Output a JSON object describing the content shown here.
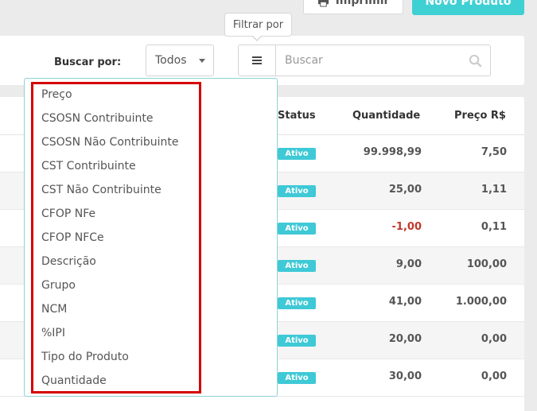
{
  "header": {
    "print_label": "Imprimir",
    "new_product_label": "Novo Produto",
    "tooltip": "Filtrar por"
  },
  "filter": {
    "search_by_label": "Buscar por:",
    "select_value": "Todos",
    "search_placeholder": "Buscar"
  },
  "table": {
    "columns": {
      "status": "Status",
      "quantidade": "Quantidade",
      "preco": "Preço R$"
    },
    "rows": [
      {
        "status": "Ativo",
        "quantidade": "99.998,99",
        "preco": "7,50"
      },
      {
        "status": "Ativo",
        "quantidade": "25,00",
        "preco": "1,11"
      },
      {
        "status": "Ativo",
        "quantidade": "-1,00",
        "preco": "0,11"
      },
      {
        "status": "Ativo",
        "quantidade": "9,00",
        "preco": "100,00"
      },
      {
        "status": "Ativo",
        "quantidade": "41,00",
        "preco": "1.000,00"
      },
      {
        "status": "Ativo",
        "quantidade": "20,00",
        "preco": "0,00"
      },
      {
        "status": "Ativo",
        "quantidade": "30,00",
        "preco": "0,00"
      }
    ]
  },
  "dropdown": {
    "items": [
      "Preço",
      "CSOSN Contribuinte",
      "CSOSN Não Contribuinte",
      "CST Contribuinte",
      "CST Não Contribuinte",
      "CFOP NFe",
      "CFOP NFCe",
      "Descrição",
      "Grupo",
      "NCM",
      "%IPI",
      "Tipo do Produto",
      "Quantidade"
    ]
  },
  "colors": {
    "accent": "#3fd0d4",
    "badge": "#3fc9d6",
    "negative": "#c0392b",
    "highlight_box": "#d40000"
  }
}
